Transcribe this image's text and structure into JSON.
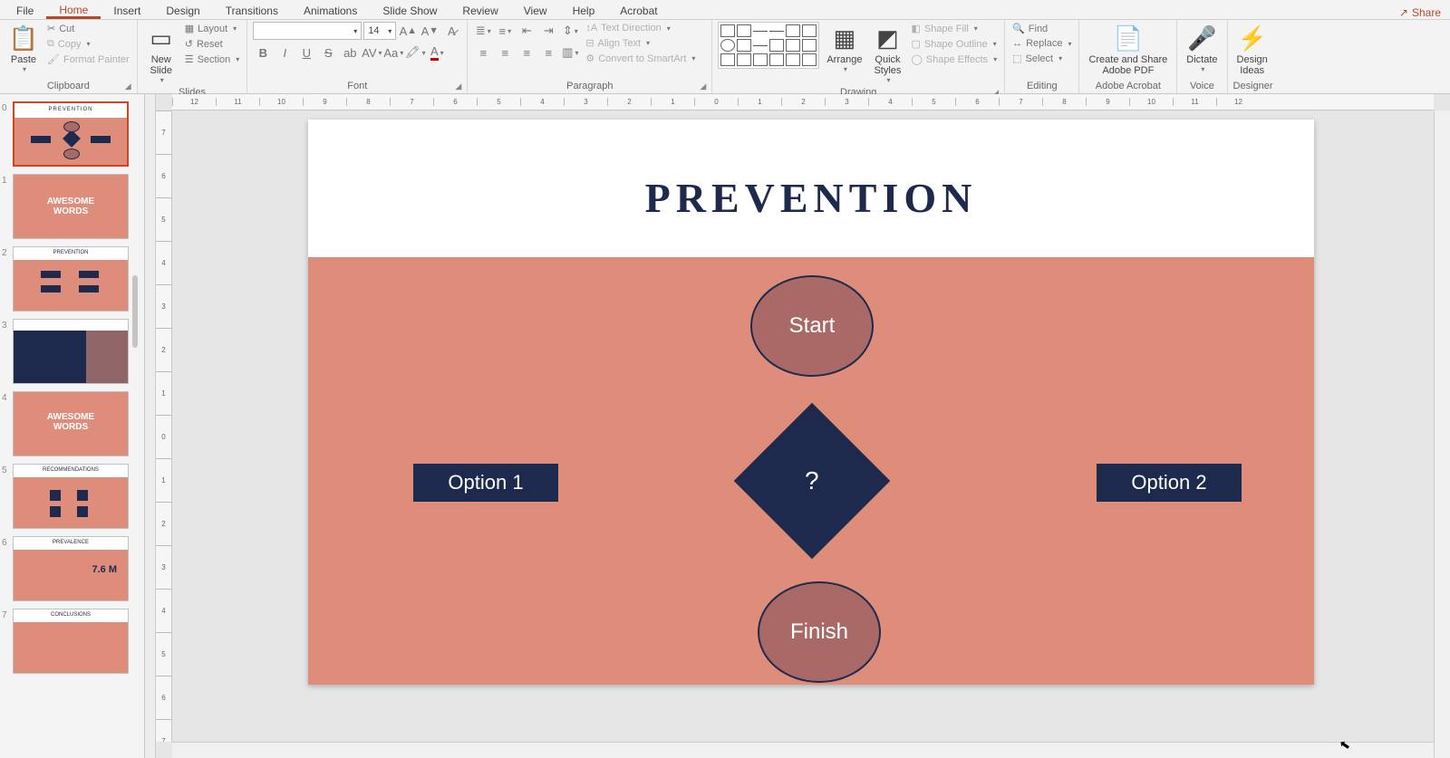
{
  "tabs": {
    "file": "File",
    "home": "Home",
    "insert": "Insert",
    "design": "Design",
    "transitions": "Transitions",
    "animations": "Animations",
    "slideshow": "Slide Show",
    "review": "Review",
    "view": "View",
    "help": "Help",
    "acrobat": "Acrobat"
  },
  "share": "Share",
  "clipboard": {
    "paste": "Paste",
    "cut": "Cut",
    "copy": "Copy",
    "painter": "Format Painter",
    "label": "Clipboard"
  },
  "slides": {
    "new": "New\nSlide",
    "layout": "Layout",
    "reset": "Reset",
    "section": "Section",
    "label": "Slides"
  },
  "font": {
    "name": "",
    "size": "14",
    "label": "Font"
  },
  "paragraph": {
    "textdir": "Text Direction",
    "align": "Align Text",
    "smartart": "Convert to SmartArt",
    "label": "Paragraph"
  },
  "drawing": {
    "arrange": "Arrange",
    "quick": "Quick\nStyles",
    "fill": "Shape Fill",
    "outline": "Shape Outline",
    "effects": "Shape Effects",
    "label": "Drawing"
  },
  "editing": {
    "find": "Find",
    "replace": "Replace",
    "select": "Select",
    "label": "Editing"
  },
  "acrobat_group": {
    "btn": "Create and Share\nAdobe PDF",
    "label": "Adobe Acrobat"
  },
  "voice": {
    "dictate": "Dictate",
    "label": "Voice"
  },
  "designer": {
    "ideas": "Design\nIdeas",
    "label": "Designer"
  },
  "ruler_h": [
    "12",
    "11",
    "10",
    "9",
    "8",
    "7",
    "6",
    "5",
    "4",
    "3",
    "2",
    "1",
    "0",
    "1",
    "2",
    "3",
    "4",
    "5",
    "6",
    "7",
    "8",
    "9",
    "10",
    "11",
    "12"
  ],
  "ruler_v": [
    "7",
    "6",
    "5",
    "4",
    "3",
    "2",
    "1",
    "0",
    "1",
    "2",
    "3",
    "4",
    "5",
    "6",
    "7"
  ],
  "thumbs": [
    "0",
    "1",
    "2",
    "3",
    "4",
    "5",
    "6",
    "7"
  ],
  "slide": {
    "title": "PREVENTION",
    "start": "Start",
    "finish": "Finish",
    "opt1": "Option 1",
    "opt2": "Option 2",
    "q": "?"
  },
  "thumb_text": {
    "awesome": "AWESOME\nWORDS",
    "prevalence": "7.6 M"
  }
}
